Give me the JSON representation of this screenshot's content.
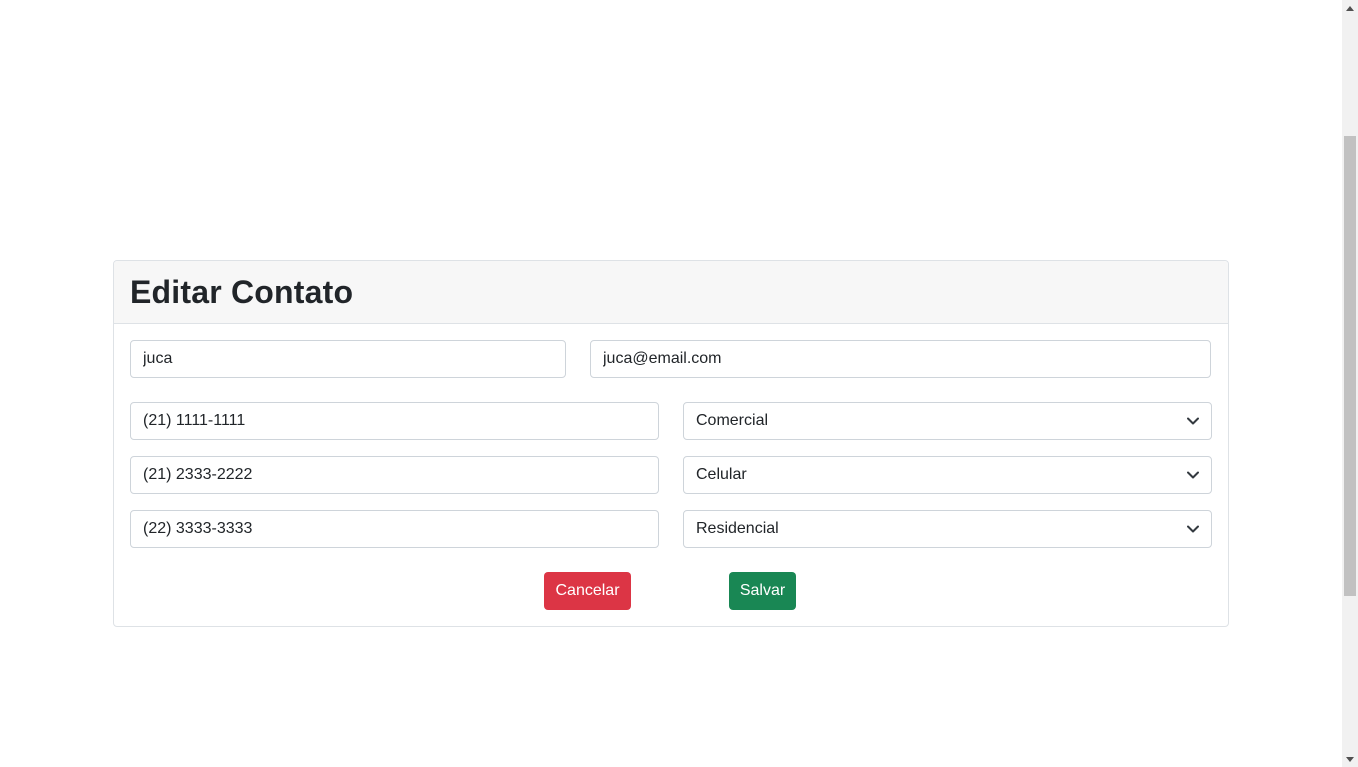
{
  "form": {
    "title": "Editar Contato",
    "name_value": "juca",
    "email_value": "juca@email.com",
    "phones": [
      {
        "number": "(21) 1111-1111",
        "type": "Comercial"
      },
      {
        "number": "(21) 2333-2222",
        "type": "Celular"
      },
      {
        "number": "(22) 3333-3333",
        "type": "Residencial"
      }
    ],
    "cancel_label": "Cancelar",
    "save_label": "Salvar"
  },
  "colors": {
    "cancel": "#dc3545",
    "save": "#198754",
    "header_bg": "#f7f7f7"
  },
  "icons": {
    "select_arrow": "chevron-down-icon",
    "scroll_up": "scroll-up-arrow-icon",
    "scroll_down": "scroll-down-arrow-icon"
  }
}
